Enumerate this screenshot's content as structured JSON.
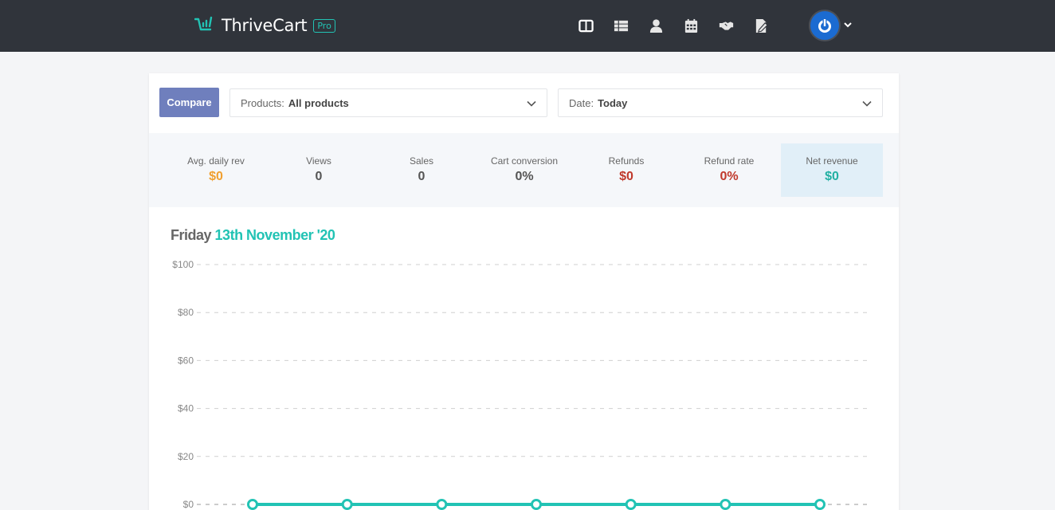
{
  "app": {
    "logo_prefix": "Thrive",
    "logo_suffix": "Cart",
    "logo_badge": "Pro"
  },
  "nav": {
    "icons": [
      "dashboard-icon",
      "list-icon",
      "user-icon",
      "calendar-icon",
      "handshake-icon",
      "edit-document-icon"
    ]
  },
  "filters": {
    "compare_label": "Compare",
    "products_label": "Products:",
    "products_value": "All products",
    "date_label": "Date:",
    "date_value": "Today"
  },
  "stats": [
    {
      "title": "Avg. daily rev",
      "value": "$0",
      "color": "#f0a030"
    },
    {
      "title": "Views",
      "value": "0",
      "color": "#555555"
    },
    {
      "title": "Sales",
      "value": "0",
      "color": "#555555"
    },
    {
      "title": "Cart conversion",
      "value": "0%",
      "color": "#555555"
    },
    {
      "title": "Refunds",
      "value": "$0",
      "color": "#c0392b"
    },
    {
      "title": "Refund rate",
      "value": "0%",
      "color": "#c0392b"
    },
    {
      "title": "Net revenue",
      "value": "$0",
      "color": "#22b0a3"
    }
  ],
  "chart_header": {
    "day": "Friday",
    "date": "13th November '20"
  },
  "chart_data": {
    "type": "line",
    "title": "",
    "xlabel": "",
    "ylabel": "",
    "ylim": [
      0,
      100
    ],
    "yticks": [
      "$100",
      "$80",
      "$60",
      "$40",
      "$20",
      "$0"
    ],
    "ytick_values": [
      100,
      80,
      60,
      40,
      20,
      0
    ],
    "grid": true,
    "series": [
      {
        "values": [
          0,
          0,
          0,
          0,
          0,
          0,
          0
        ],
        "color": "#22c3b4"
      }
    ]
  },
  "colors": {
    "accent": "#22c3b4",
    "topbar": "#30343b",
    "compare": "#6f7fbd"
  }
}
